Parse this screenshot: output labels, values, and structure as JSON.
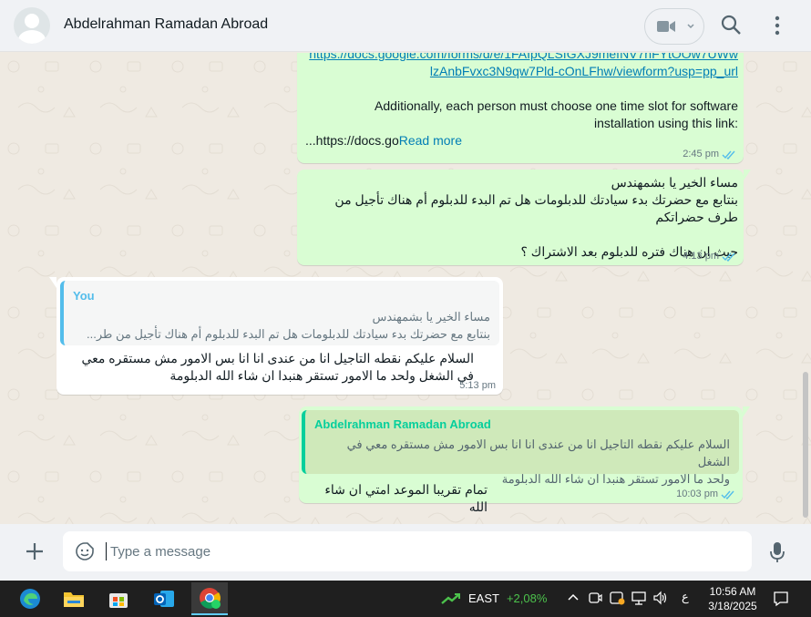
{
  "header": {
    "contact_name": "Abdelrahman Ramadan Abroad"
  },
  "messages": {
    "m1": {
      "link_line1": "https://docs.google.com/forms/d/e/1FAIpQLSfGXJ9mefNV7hFYtOOw7UWw",
      "link_line2": "lzAnbFvxc3N9qw7Pld-cOnLFhw/viewform?usp=pp_url",
      "text_line1": "Additionally, each person must choose one time slot for software",
      "text_line2": "installation using this link:",
      "truncated": "...https://docs.go",
      "read_more": "Read more",
      "time": "2:45 pm"
    },
    "m2": {
      "text": "مساء الخير يا بشمهندس\nبنتابع مع حضرتك بدء سيادتك للدبلومات هل تم البدء للدبلوم أم هناك تأجيل من طرف حضراتكم\n\nحيث ان هناك فتره للدبلوم بعد الاشتراك ؟",
      "time": "4:13 pm"
    },
    "m3": {
      "quote_name": "You",
      "quote_text": "مساء الخير يا بشمهندس\nبنتابع مع حضرتك بدء سيادتك للدبلومات هل تم البدء للدبلوم أم هناك تأجيل من طر...",
      "text": "السلام عليكم نقطه التاجيل انا من عندى انا انا بس الامور مش مستقره معي في الشغل ولحد ما الامور تستقر هنبدا ان شاء الله الدبلومة",
      "time": "5:13 pm"
    },
    "m4": {
      "quote_name": "Abdelrahman Ramadan Abroad",
      "quote_text": "السلام عليكم نقطه التاجيل انا من عندى انا انا بس الامور مش مستقره معي في الشغل\nولحد ما الامور تستقر هنبدا ان شاء الله الدبلومة",
      "text": "تمام تقريبا الموعد امتي ان شاء الله",
      "time": "10:03 pm"
    }
  },
  "composer": {
    "placeholder": "Type a message"
  },
  "taskbar": {
    "stock_name": "EAST",
    "stock_change": "+2,08%",
    "lang": "ع",
    "time": "10:56 AM",
    "date": "3/18/2025"
  },
  "colors": {
    "outgoing_bubble": "#d9fdd3",
    "incoming_bubble": "#ffffff",
    "read_ticks": "#53bdeb",
    "link": "#027eb5"
  }
}
